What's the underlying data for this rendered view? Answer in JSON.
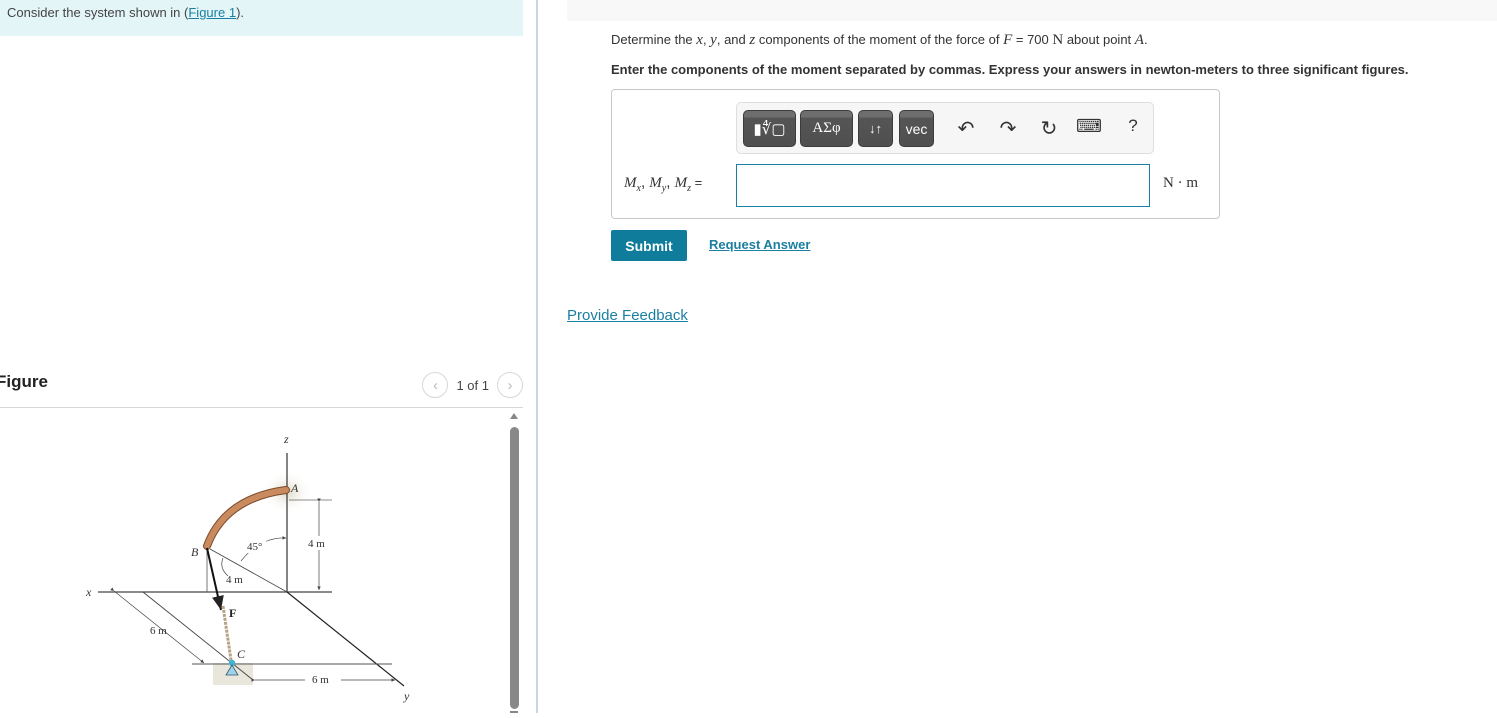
{
  "intro": {
    "prefix": "Consider the system shown in (",
    "link": "Figure 1",
    "suffix": ")."
  },
  "figure_panel": {
    "title": "Figure",
    "pager_text": "1 of 1",
    "prev_icon": "chevron-left-icon",
    "next_icon": "chevron-right-icon",
    "labels": {
      "z_axis": "z",
      "x_axis": "x",
      "y_axis": "y",
      "point_a": "A",
      "point_b": "B",
      "point_c": "C",
      "force": "F",
      "angle": "45°",
      "dim_height": "4 m",
      "dim_radius": "4 m",
      "dim_x": "6 m",
      "dim_y": "6 m"
    },
    "colors": {
      "rod": "#c98a5e",
      "rod_edge": "#7a4a2c",
      "support": "#7fc3e0"
    }
  },
  "question": {
    "line1": {
      "t1": "Determine the ",
      "x": "x",
      "c1": ", ",
      "y": "y",
      "t2": ", and ",
      "z": "z",
      "t3": " components of the moment of the force of ",
      "F": "F",
      "t4": " = 700 ",
      "N": "N",
      "t5": " about point ",
      "A": "A",
      "t6": "."
    },
    "line2": "Enter the components of the moment separated by commas. Express your answers in newton-meters to three significant figures."
  },
  "toolbar": {
    "templates_label": "▮∜▢",
    "greek_label": "ΑΣφ",
    "arrows_label": "↓↑",
    "vec_label": "vec",
    "undo_icon": "↶",
    "redo_icon": "↷",
    "reset_icon": "↻",
    "keyboard_icon": "⌨",
    "help_label": "?"
  },
  "answer": {
    "label_Mx": "M",
    "sub_x": "x",
    "label_My": "M",
    "sub_y": "y",
    "label_Mz": "M",
    "sub_z": "z",
    "sep": ", ",
    "equals": " =",
    "value": "",
    "unit": "N · m"
  },
  "actions": {
    "submit": "Submit",
    "request_answer": "Request Answer",
    "feedback": "Provide Feedback"
  },
  "colors": {
    "accent": "#0e7c9a",
    "link": "#1a7fa0",
    "intro_bg": "#e4f5f7"
  }
}
